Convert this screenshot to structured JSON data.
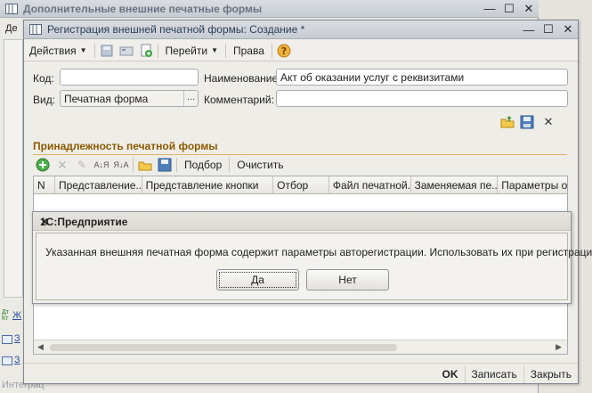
{
  "background_window": {
    "title": "Дополнительные внешние печатные формы",
    "tab_fragment": "Де",
    "side_labels": [
      "Ж",
      "З",
      "З"
    ],
    "dt_kt": "Дт\nКт",
    "footer_fragment": "Интеграц"
  },
  "window": {
    "title": "Регистрация внешней печатной формы: Создание *"
  },
  "toolbar": {
    "actions_label": "Действия",
    "goto_label": "Перейти",
    "rights_label": "Права",
    "help_icon": "help-icon"
  },
  "form": {
    "code_label": "Код:",
    "code_value": "",
    "name_label": "Наименование:",
    "name_value": "Акт об оказании услуг с реквизитами",
    "kind_label": "Вид:",
    "kind_value": "Печатная форма",
    "kind_button": "...",
    "comment_label": "Комментарий:",
    "comment_value": ""
  },
  "section": {
    "title": "Принадлежность печатной формы"
  },
  "table_toolbar": {
    "pick_label": "Подбор",
    "clear_label": "Очистить"
  },
  "table": {
    "columns": [
      "N",
      "Представление...",
      "Представление кнопки",
      "Отбор",
      "Файл печатной...",
      "Заменяемая пе...",
      "Параметры от"
    ]
  },
  "bottom": {
    "ok_label": "OK",
    "save_label": "Записать",
    "close_label": "Закрыть"
  },
  "dialog": {
    "title": "1С:Предприятие",
    "message": "Указанная внешняя печатная форма содержит параметры авторегистрации. Использовать их при регистрации?",
    "yes_label": "Да",
    "no_label": "Нет"
  },
  "colors": {
    "section_title": "#8a5a00",
    "window_bg": "#efede8"
  }
}
